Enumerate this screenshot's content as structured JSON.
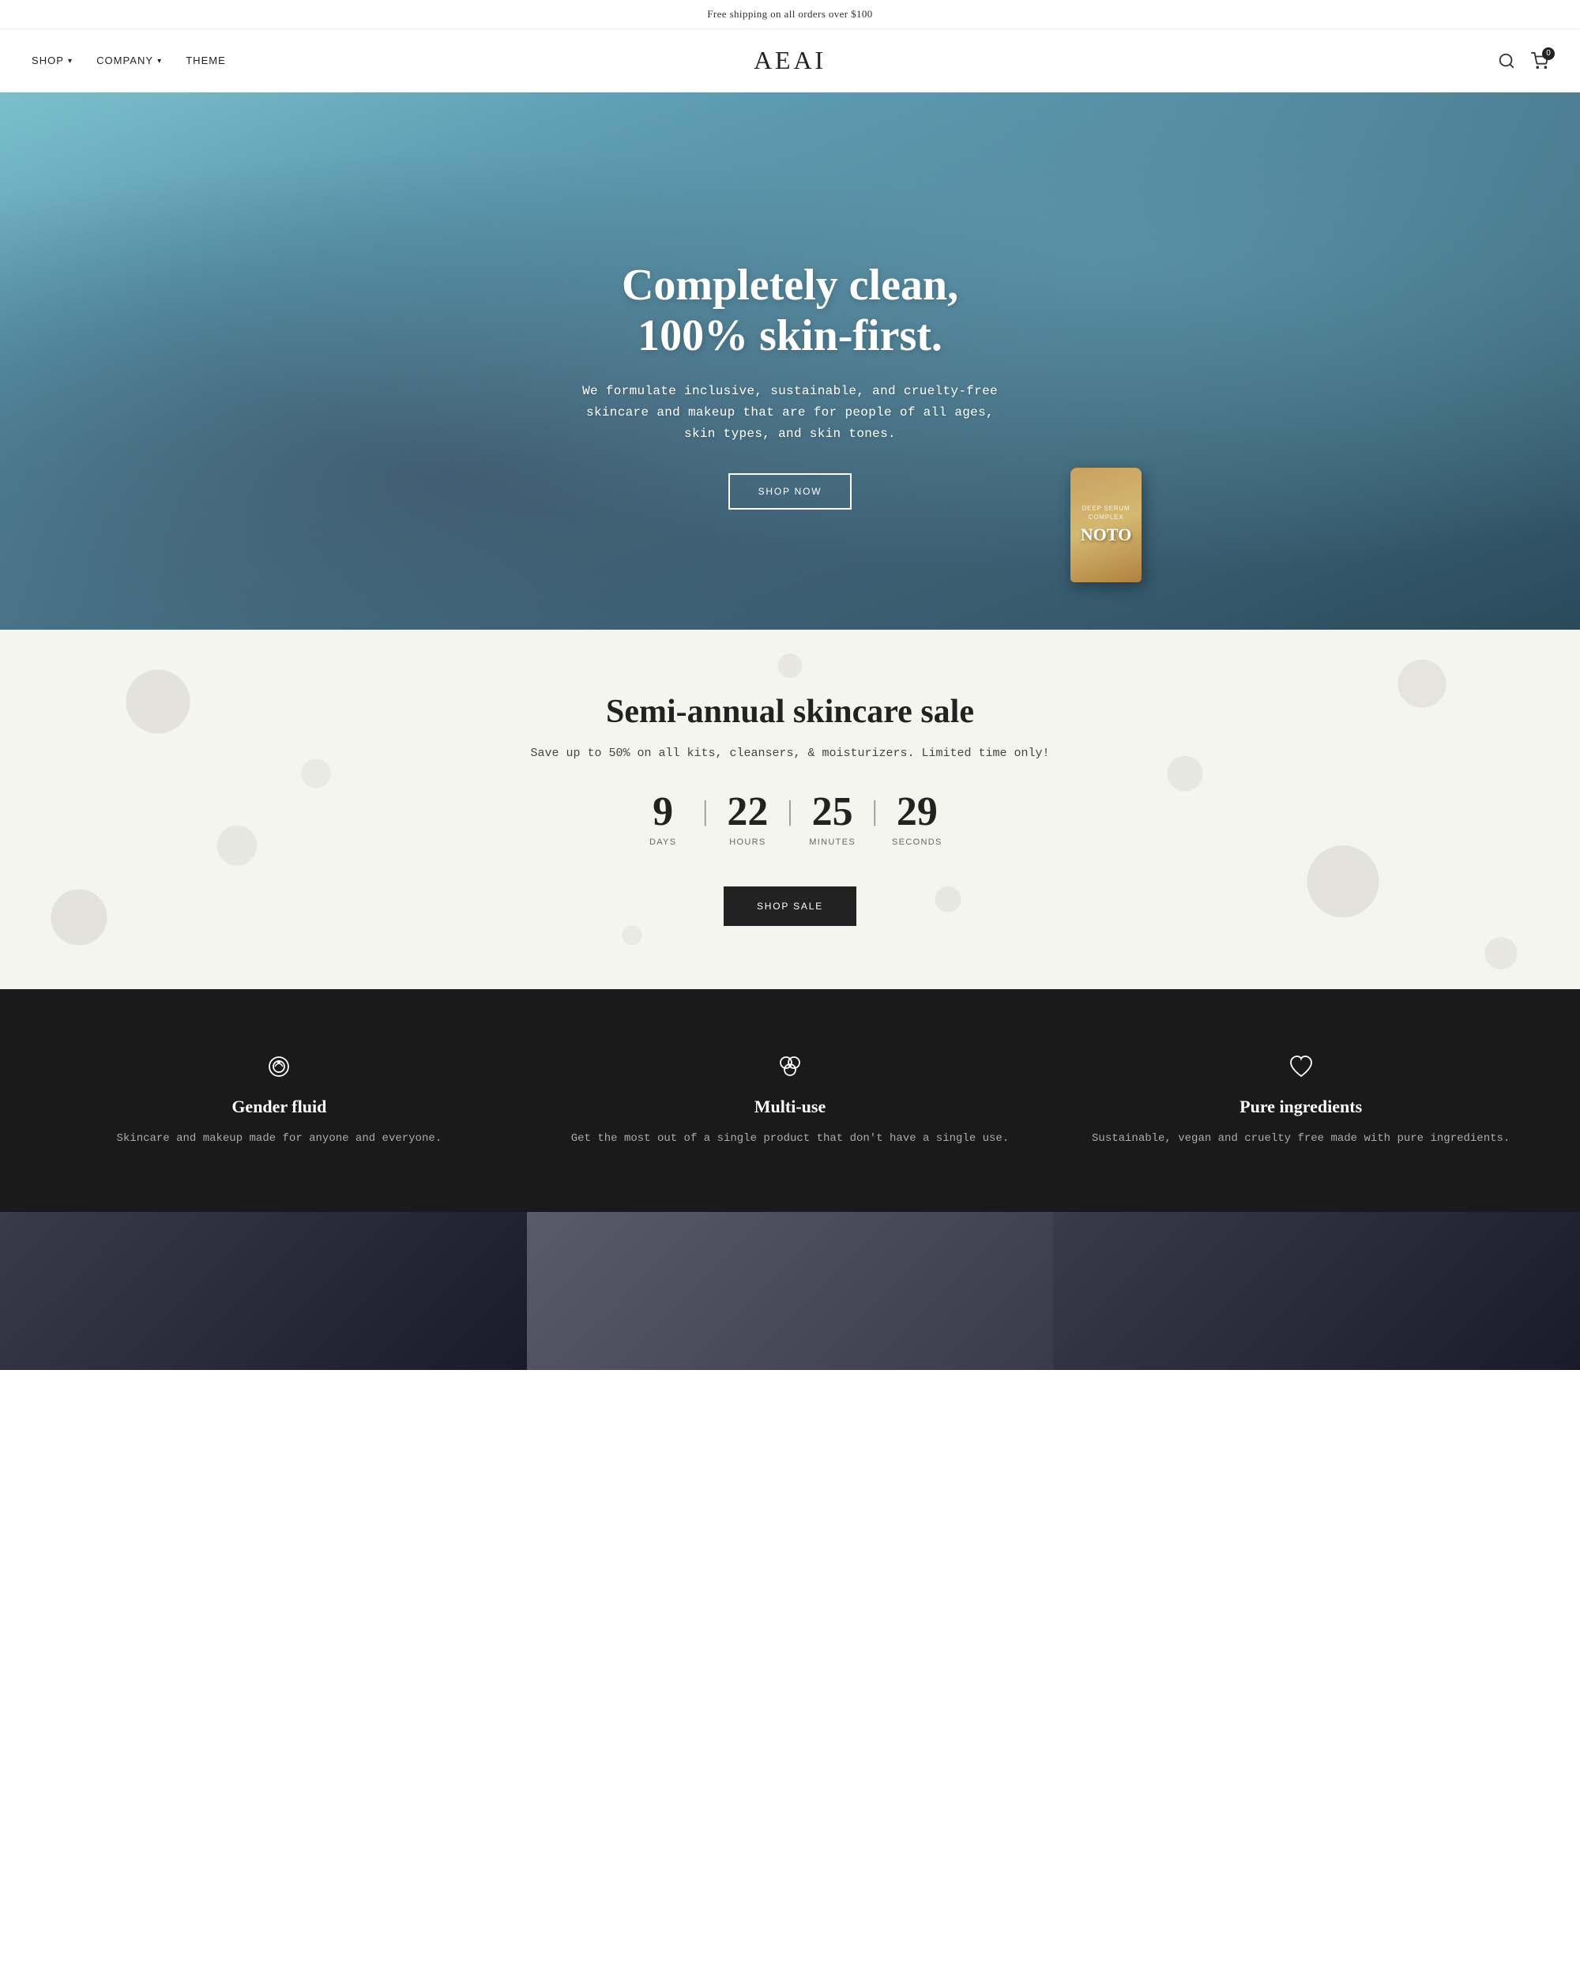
{
  "announcement": {
    "text": "Free shipping on all orders over $100"
  },
  "header": {
    "logo": "AEAI",
    "nav_left": [
      {
        "label": "SHOP",
        "has_dropdown": true
      },
      {
        "label": "COMPANY",
        "has_dropdown": true
      },
      {
        "label": "THEME",
        "has_dropdown": false
      }
    ],
    "cart_count": "0",
    "search_label": "search",
    "cart_label": "cart"
  },
  "hero": {
    "title": "Completely clean, 100% skin-first.",
    "description": "We formulate inclusive, sustainable, and cruelty-free skincare and makeup that are for people of all ages, skin types, and skin tones.",
    "cta_label": "SHOP NOW",
    "product_text": "NOTO",
    "product_sub": "DEEP SERUM"
  },
  "sale": {
    "title": "Semi-annual skincare sale",
    "description": "Save up to 50% on all kits, cleansers, & moisturizers. Limited time only!",
    "countdown": {
      "days": "9",
      "hours": "22",
      "minutes": "25",
      "seconds": "29",
      "days_label": "DAYS",
      "hours_label": "HOURS",
      "minutes_label": "MINUTES",
      "seconds_label": "SECONDS"
    },
    "cta_label": "SHOP SALE"
  },
  "features": [
    {
      "icon": "ring",
      "title": "Gender fluid",
      "description": "Skincare and makeup made for anyone and everyone."
    },
    {
      "icon": "multiuse",
      "title": "Multi-use",
      "description": "Get the most out of a single product that don't have a single use."
    },
    {
      "icon": "heart",
      "title": "Pure ingredients",
      "description": "Sustainable, vegan and cruelty free made with pure ingredients."
    }
  ],
  "previews": [
    {
      "label": "preview-left"
    },
    {
      "label": "preview-center"
    },
    {
      "label": "preview-right"
    }
  ]
}
